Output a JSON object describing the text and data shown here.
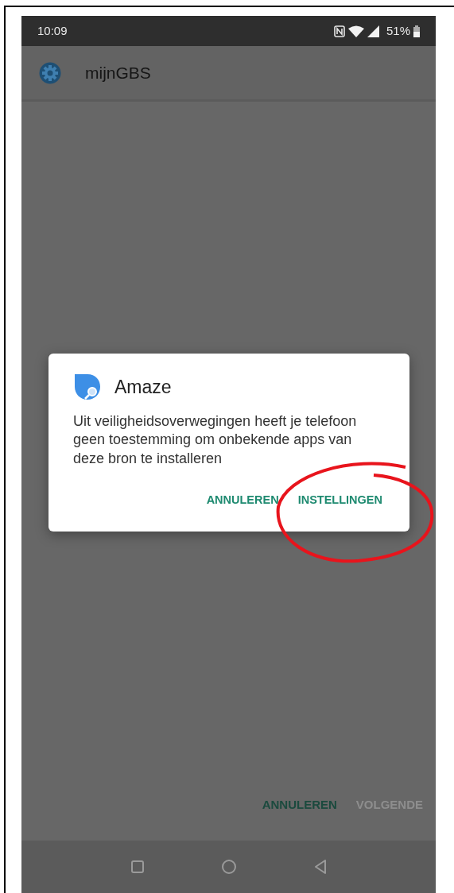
{
  "status_bar": {
    "time": "10:09",
    "battery": "51%"
  },
  "app_bar": {
    "title": "mijnGBS"
  },
  "dialog": {
    "title": "Amaze",
    "message": "Uit veiligheidsoverwegingen heeft je telefoon geen toestemming om onbekende apps van deze bron te installeren",
    "buttons": [
      {
        "label": "ANNULEREN"
      },
      {
        "label": "INSTELLINGEN"
      }
    ]
  },
  "footer_buttons": [
    {
      "label": "ANNULEREN",
      "disabled": false
    },
    {
      "label": "VOLGENDE",
      "disabled": true
    }
  ]
}
